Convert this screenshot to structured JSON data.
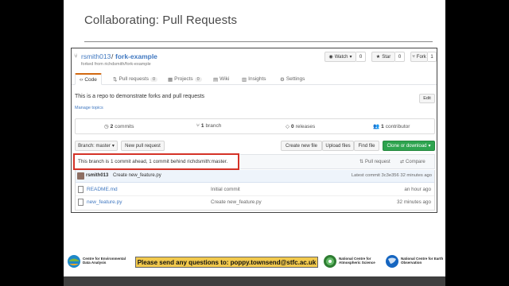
{
  "slide": {
    "title": "Collaborating: Pull Requests"
  },
  "repo": {
    "owner": "rsmith013",
    "slash": "/",
    "name": "fork-example",
    "forked_from": "forked from richdsmith/fork-example",
    "watch_label": "Watch",
    "watch_count": "0",
    "star_label": "Star",
    "star_count": "0",
    "fork_label": "Fork",
    "fork_count": "1"
  },
  "tabs": [
    {
      "label": "Code",
      "icon": "code-icon"
    },
    {
      "label": "Pull requests",
      "count": "0",
      "icon": "pull-request-icon"
    },
    {
      "label": "Projects",
      "count": "0",
      "icon": "project-icon"
    },
    {
      "label": "Wiki",
      "icon": "book-icon"
    },
    {
      "label": "Insights",
      "icon": "graph-icon"
    },
    {
      "label": "Settings",
      "icon": "gear-icon"
    }
  ],
  "description": "This is a repo to demonstrate forks and pull requests",
  "manage_topics": "Manage topics",
  "edit_label": "Edit",
  "summary": {
    "commits_num": "2",
    "commits_label": "commits",
    "branch_num": "1",
    "branch_label": "branch",
    "releases_num": "0",
    "releases_label": "releases",
    "contributor_num": "1",
    "contributor_label": "contributor"
  },
  "toolbar": {
    "branch": "Branch: master",
    "new_pr": "New pull request",
    "create_file": "Create new file",
    "upload": "Upload files",
    "find": "Find file",
    "clone": "Clone or download"
  },
  "notice": {
    "text": "This branch is 1 commit ahead, 1 commit behind richdsmith:master.",
    "pull_request": "Pull request",
    "compare": "Compare"
  },
  "latest_commit": {
    "author": "rsmith013",
    "message": "Create new_feature.py",
    "info": "Latest commit 3c3e356 32 minutes ago"
  },
  "files": [
    {
      "name": "README.md",
      "message": "Initial commit",
      "age": "an hour ago"
    },
    {
      "name": "new_feature.py",
      "message": "Create new_feature.py",
      "age": "32 minutes ago"
    }
  ],
  "footer": {
    "banner": "Please send any questions to: poppy.townsend@stfc.ac.uk",
    "cedadata": "Centre for Environmental Data Analysis",
    "ncas": "National Centre for Atmospheric Science",
    "nceo": "National Centre for Earth Observation"
  },
  "colors": {
    "accent_link": "#4078c0",
    "clone_green": "#2ea44f",
    "notice_border": "#d43227",
    "banner_yellow": "#f2c94c"
  }
}
